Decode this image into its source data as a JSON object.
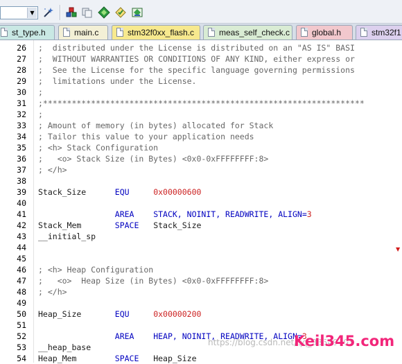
{
  "toolbar": {
    "target_combo_value": "",
    "icons": [
      "configure-wand-icon",
      "insert-component-icon",
      "copy-item-icon",
      "manage-packs-icon",
      "select-device-icon",
      "pack-installer-icon"
    ]
  },
  "tabs": [
    {
      "label": "st_type.h",
      "color": "#c9e8e4"
    },
    {
      "label": "main.c",
      "color": "#f3f0d6"
    },
    {
      "label": "stm32f0xx_flash.c",
      "color": "#f7e98e"
    },
    {
      "label": "meas_self_check.c",
      "color": "#d9ecd4"
    },
    {
      "label": "global.h",
      "color": "#f2c8cd"
    },
    {
      "label": "stm32f1",
      "color": "#dcd0ee"
    }
  ],
  "editor": {
    "lines": [
      {
        "n": "26",
        "parts": [
          {
            "t": ";  distributed under the License is distributed on an \"AS IS\" BASI",
            "c": "cm"
          }
        ]
      },
      {
        "n": "27",
        "parts": [
          {
            "t": ";  WITHOUT WARRANTIES OR CONDITIONS OF ANY KIND, either express or",
            "c": "cm"
          }
        ]
      },
      {
        "n": "28",
        "parts": [
          {
            "t": ";  See the License for the specific language governing permissions",
            "c": "cm"
          }
        ]
      },
      {
        "n": "29",
        "parts": [
          {
            "t": ";  limitations under the License.",
            "c": "cm"
          }
        ]
      },
      {
        "n": "30",
        "parts": [
          {
            "t": ";",
            "c": "cm"
          }
        ]
      },
      {
        "n": "31",
        "parts": [
          {
            "t": ";*******************************************************************",
            "c": "cm"
          }
        ]
      },
      {
        "n": "32",
        "parts": [
          {
            "t": ";",
            "c": "cm"
          }
        ]
      },
      {
        "n": "33",
        "parts": [
          {
            "t": "; Amount of memory (in bytes) allocated for Stack",
            "c": "cm"
          }
        ]
      },
      {
        "n": "34",
        "parts": [
          {
            "t": "; Tailor this value to your application needs",
            "c": "cm"
          }
        ]
      },
      {
        "n": "35",
        "parts": [
          {
            "t": "; <h> Stack Configuration",
            "c": "cm"
          }
        ]
      },
      {
        "n": "36",
        "parts": [
          {
            "t": ";   <o> Stack Size (in Bytes) <0x0-0xFFFFFFFF:8>",
            "c": "cm"
          }
        ]
      },
      {
        "n": "37",
        "parts": [
          {
            "t": "; </h>",
            "c": "cm"
          }
        ]
      },
      {
        "n": "38",
        "parts": []
      },
      {
        "n": "39",
        "parts": [
          {
            "t": "Stack_Size      ",
            "c": "nm"
          },
          {
            "t": "EQU",
            "c": "kw"
          },
          {
            "t": "     ",
            "c": "plain"
          },
          {
            "t": "0x00000600",
            "c": "num"
          }
        ]
      },
      {
        "n": "40",
        "parts": []
      },
      {
        "n": "41",
        "parts": [
          {
            "t": "                ",
            "c": "plain"
          },
          {
            "t": "AREA",
            "c": "kw"
          },
          {
            "t": "    ",
            "c": "plain"
          },
          {
            "t": "STACK, NOINIT, READWRITE, ALIGN=",
            "c": "kw"
          },
          {
            "t": "3",
            "c": "num"
          }
        ]
      },
      {
        "n": "42",
        "parts": [
          {
            "t": "Stack_Mem       ",
            "c": "nm"
          },
          {
            "t": "SPACE",
            "c": "kw"
          },
          {
            "t": "   ",
            "c": "plain"
          },
          {
            "t": "Stack_Size",
            "c": "nm"
          }
        ]
      },
      {
        "n": "43",
        "parts": [
          {
            "t": "__initial_sp",
            "c": "nm"
          }
        ]
      },
      {
        "n": "44",
        "parts": []
      },
      {
        "n": "45",
        "parts": []
      },
      {
        "n": "46",
        "parts": [
          {
            "t": "; <h> Heap Configuration",
            "c": "cm"
          }
        ]
      },
      {
        "n": "47",
        "parts": [
          {
            "t": ";   <o>  Heap Size (in Bytes) <0x0-0xFFFFFFFF:8>",
            "c": "cm"
          }
        ]
      },
      {
        "n": "48",
        "parts": [
          {
            "t": "; </h>",
            "c": "cm"
          }
        ]
      },
      {
        "n": "49",
        "parts": []
      },
      {
        "n": "50",
        "parts": [
          {
            "t": "Heap_Size       ",
            "c": "nm"
          },
          {
            "t": "EQU",
            "c": "kw"
          },
          {
            "t": "     ",
            "c": "plain"
          },
          {
            "t": "0x00000200",
            "c": "num"
          }
        ]
      },
      {
        "n": "51",
        "parts": []
      },
      {
        "n": "52",
        "parts": [
          {
            "t": "                ",
            "c": "plain"
          },
          {
            "t": "AREA",
            "c": "kw"
          },
          {
            "t": "    ",
            "c": "plain"
          },
          {
            "t": "HEAP, NOINIT, READWRITE, ALIGN=",
            "c": "kw"
          },
          {
            "t": "3",
            "c": "num"
          }
        ]
      },
      {
        "n": "53",
        "parts": [
          {
            "t": "__heap_base",
            "c": "nm"
          }
        ]
      },
      {
        "n": "54",
        "parts": [
          {
            "t": "Heap_Mem        ",
            "c": "nm"
          },
          {
            "t": "SPACE",
            "c": "kw"
          },
          {
            "t": "   ",
            "c": "plain"
          },
          {
            "t": "Heap_Size",
            "c": "nm"
          }
        ]
      }
    ]
  },
  "watermark": "https://blog.csdn.net/qq_38549703",
  "logo": "Keil345.com"
}
